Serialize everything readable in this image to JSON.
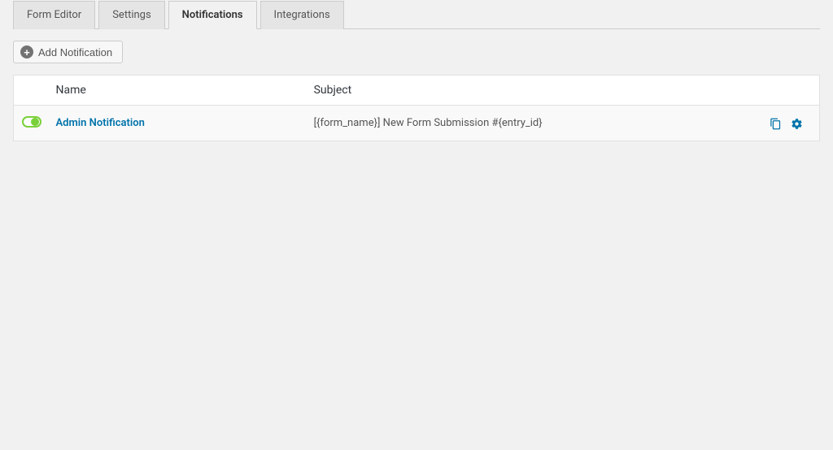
{
  "tabs": [
    {
      "label": "Form Editor",
      "active": false
    },
    {
      "label": "Settings",
      "active": false
    },
    {
      "label": "Notifications",
      "active": true
    },
    {
      "label": "Integrations",
      "active": false
    }
  ],
  "toolbar": {
    "add_label": "Add Notification"
  },
  "table": {
    "headers": {
      "name": "Name",
      "subject": "Subject"
    },
    "rows": [
      {
        "enabled": true,
        "name": "Admin Notification",
        "subject": "[{form_name}] New Form Submission #{entry_id}"
      }
    ]
  }
}
